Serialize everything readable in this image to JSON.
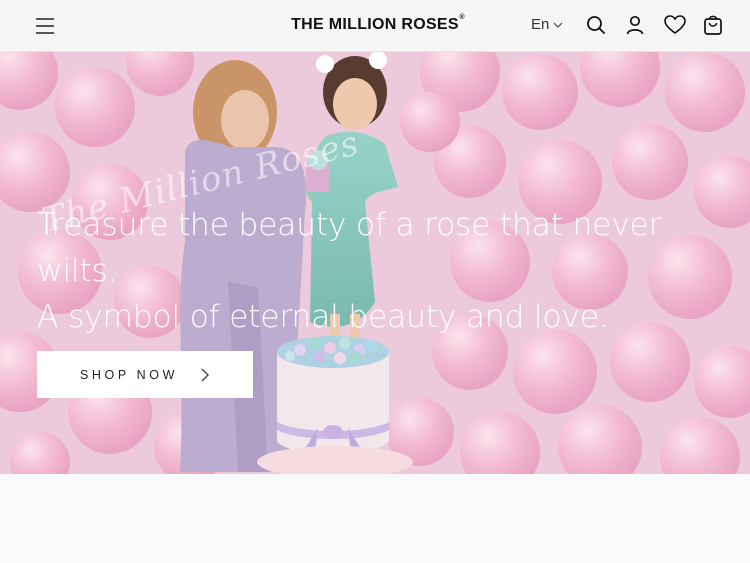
{
  "header": {
    "logo": "THE MILLION ROSES",
    "logo_mark": "®",
    "language": "En",
    "icons": [
      "menu-icon",
      "search-icon",
      "account-icon",
      "heart-icon",
      "shopping-bag-icon"
    ]
  },
  "hero": {
    "script_brand": "The Million Roses",
    "headline_line1": "Treasure the beauty of a rose that never wilts.",
    "headline_line2": "A symbol of eternal beauty and love.",
    "cta_label": "SHOP NOW",
    "colors": {
      "balloon_pink": "#f2b6cf",
      "overlay": "#e9cadb",
      "text": "#ffffff"
    }
  }
}
